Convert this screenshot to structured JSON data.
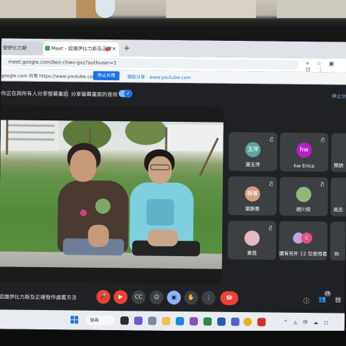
{
  "browser": {
    "tabs": [
      {
        "title": "使伊比力斯",
        "active": false
      },
      {
        "title": "Meet - 認識伊比力斯及正確",
        "active": true
      }
    ],
    "new_tab_symbol": "+",
    "address": "meet.google.com/bez-chwv-gxz?authuser=1",
    "address_icons": "⋄ ☆ ▣ ⊡ ⋮"
  },
  "share_bar": {
    "text": "google.com 共用 https://www.youtube.com.",
    "stop_button": "停止共用",
    "other_share": "選取分享 · www.youtube.com"
  },
  "meet_header": {
    "presenting_text": "你正在與所有人分享螢幕畫面",
    "share_audio_label": "分享螢幕畫面的音效",
    "stop_presenting": "停止分"
  },
  "participants": [
    {
      "name": "葉玉萍",
      "avatar_text": "玉萍",
      "avatar_color": "#5aa6a0",
      "muted": true
    },
    {
      "name": "hw Erica",
      "avatar_text": "hw",
      "avatar_color": "#b620c8",
      "muted": true
    },
    {
      "name": "簡語",
      "avatar_text": "",
      "avatar_color": "#6a7a8a",
      "muted": true
    },
    {
      "name": "葉靜惠",
      "avatar_text": "靜惠",
      "avatar_color": "#d59e7a",
      "muted": true
    },
    {
      "name": "趙川俊",
      "avatar_text": "",
      "avatar_color": "#8fb87a",
      "muted": true
    },
    {
      "name": "吳志",
      "avatar_text": "",
      "avatar_color": "#7a6a5a",
      "muted": false
    },
    {
      "name": "黃霓",
      "avatar_text": "",
      "avatar_color": "#e7b9c4",
      "muted": true
    },
    {
      "name": "還有另外 12 位使用者",
      "avatar_text": "C",
      "avatar_color": "#e04e8c",
      "muted": false
    },
    {
      "name": "你",
      "avatar_text": "",
      "avatar_color": "#4a4a4a",
      "muted": false
    }
  ],
  "bottom_bar": {
    "meeting_title": "認識伊比力斯及正確發作處置方法",
    "participant_count": "25"
  },
  "taskbar": {
    "search_label": "搜尋",
    "tray_text": "^ ◬ 中 ☁ ◻"
  }
}
